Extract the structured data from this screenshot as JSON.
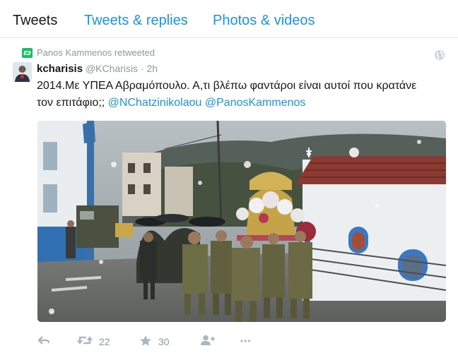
{
  "tabs": {
    "tweets": "Tweets",
    "replies": "Tweets & replies",
    "media": "Photos & videos"
  },
  "tweet": {
    "retweeted_by": "Panos Kammenos retweeted",
    "author_name": "kcharisis",
    "author_handle": "@KCharisis",
    "separator": "·",
    "time": "2h",
    "text_part1": "2014.Με ΥΠΕΑ Αβραμόπουλο. Α,τι βλέπω φαντάροι είναι αυτοί που κρατάνε τον επιτάφιο;; ",
    "mention1": "@NChatzinikolaou",
    "mention2": "@PanosKammenos",
    "photo_icon": "photo-religious-procession-soldiers",
    "retweets": "22",
    "favorites": "30",
    "more": "•••"
  },
  "colors": {
    "accent": "#1b95e0",
    "retweet_green": "#17bf63",
    "muted": "#8899a6",
    "icon_gray": "#aab8c2"
  },
  "icons": {
    "retweet_badge": "retweet-icon",
    "globe": "globe-icon",
    "reply": "reply-icon",
    "retweet": "retweet-icon",
    "favorite": "star-icon",
    "follow": "follow-icon",
    "more": "more-icon"
  }
}
